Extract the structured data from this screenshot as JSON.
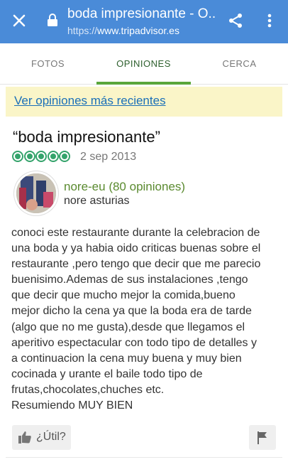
{
  "browser": {
    "title": "boda impresionante - O...",
    "url_scheme": "https://",
    "url_host": "www.tripadvisor.es",
    "icons": [
      "close-icon",
      "lock-icon",
      "share-icon",
      "more-vertical-icon"
    ],
    "color": "#4a8bd8"
  },
  "tabs": [
    {
      "label": "FOTOS",
      "active": false
    },
    {
      "label": "OPINIONES",
      "active": true
    },
    {
      "label": "CERCA",
      "active": false
    }
  ],
  "notice": {
    "link_text": "Ver opiniones más recientes"
  },
  "review": {
    "title": "“boda impresionante”",
    "rating": 5,
    "rating_max": 5,
    "rating_color": "#34a36b",
    "date": "2 sep 2013",
    "author": "nore-eu (80 opiniones)",
    "location": "nore asturias",
    "body_lines": [
      "conoci este restaurante durante la celebracion de",
      "una boda y ya habia oido criticas buenas sobre el",
      "restaurante ,pero tengo que decir que me parecio",
      "buenisimo.Ademas de sus instalaciones ,tengo",
      "que decir que mucho mejor la comida,bueno",
      "mejor dicho la cena ya que la boda era de tarde",
      "(algo que no me gusta),desde que llegamos el",
      "aperitivo espectacular con todo tipo de detalles y",
      "a continuacion la cena muy buena y muy bien",
      "cocinada y urante el baile todo tipo de",
      "frutas,chocolates,chuches etc.",
      "Resumiendo MUY BIEN"
    ]
  },
  "actions": {
    "helpful_label": "¿Útil?"
  }
}
